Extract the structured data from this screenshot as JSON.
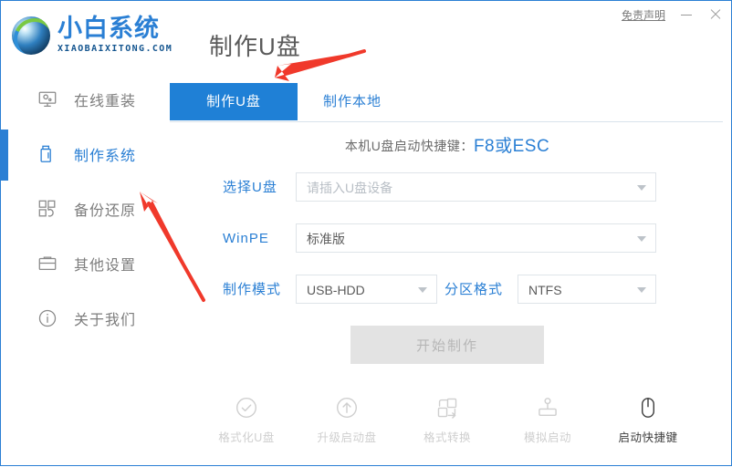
{
  "window": {
    "title": "制作U盘",
    "disclaimer": "免责声明",
    "minimize_icon": "minimize-icon",
    "close_icon": "close-icon"
  },
  "logo": {
    "name_cn": "小白系统",
    "name_en": "XIAOBAIXITONG.COM",
    "mark_icon": "recycle-circle-logo-icon"
  },
  "sidebar": {
    "items": [
      {
        "label": "在线重装",
        "icon": "monitor-icon",
        "active": false
      },
      {
        "label": "制作系统",
        "icon": "usb-drive-icon",
        "active": true
      },
      {
        "label": "备份还原",
        "icon": "backup-blocks-icon",
        "active": false
      },
      {
        "label": "其他设置",
        "icon": "toolbox-icon",
        "active": false
      },
      {
        "label": "关于我们",
        "icon": "info-circle-icon",
        "active": false
      }
    ]
  },
  "tabs": [
    {
      "label": "制作U盘",
      "active": true
    },
    {
      "label": "制作本地",
      "active": false
    }
  ],
  "hint": {
    "label": "本机U盘启动快捷键：",
    "key": "F8或ESC"
  },
  "form": {
    "usb": {
      "label": "选择U盘",
      "value": "",
      "placeholder": "请插入U盘设备",
      "caret_icon": "chevron-down-icon"
    },
    "winpe": {
      "label": "WinPE",
      "value": "标准版",
      "caret_icon": "chevron-down-icon"
    },
    "mode": {
      "label": "制作模式",
      "value": "USB-HDD",
      "caret_icon": "chevron-down-icon"
    },
    "partition": {
      "label": "分区格式",
      "value": "NTFS",
      "caret_icon": "chevron-down-icon"
    }
  },
  "start_button": {
    "label": "开始制作",
    "enabled": false
  },
  "bottom_tools": [
    {
      "label": "格式化U盘",
      "icon": "check-circle-icon",
      "active": false
    },
    {
      "label": "升级启动盘",
      "icon": "arrow-up-circle-icon",
      "active": false
    },
    {
      "label": "格式转换",
      "icon": "format-convert-icon",
      "active": false
    },
    {
      "label": "模拟启动",
      "icon": "joystick-icon",
      "active": false
    },
    {
      "label": "启动快捷键",
      "icon": "mouse-icon",
      "active": true
    }
  ],
  "colors": {
    "accent_blue": "#2a7fd4",
    "tab_blue": "#1f80d6",
    "annotation_red": "#f0392b",
    "disabled_gray": "#e3e3e3"
  },
  "annotations": [
    {
      "name": "arrow-to-usb-tab",
      "color": "#f0392b"
    },
    {
      "name": "arrow-to-sidebar-make-system",
      "color": "#f0392b"
    }
  ]
}
